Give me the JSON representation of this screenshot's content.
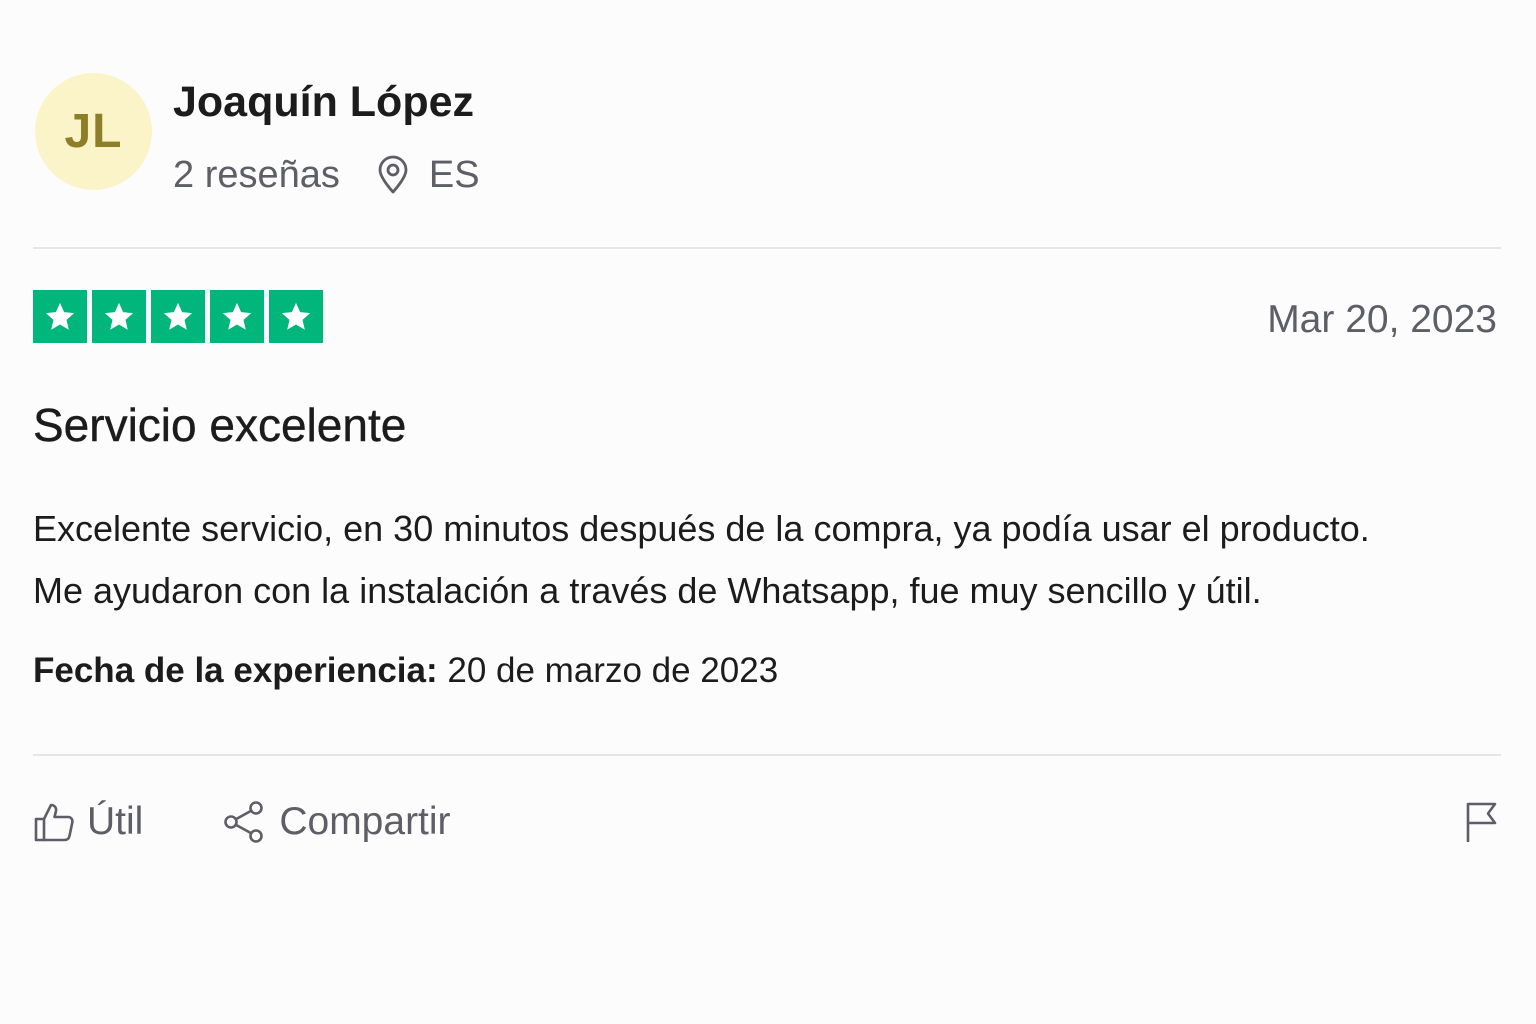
{
  "reviewer": {
    "initials": "JL",
    "name": "Joaquín López",
    "reviews_count": "2 reseñas",
    "country": "ES"
  },
  "review": {
    "rating": 5,
    "max_rating": 5,
    "date": "Mar 20, 2023",
    "title": "Servicio excelente",
    "body_line1": "Excelente servicio, en 30 minutos después de la compra, ya podía usar el producto.",
    "body_line2": "Me ayudaron con la instalación a través de Whatsapp, fue muy sencillo y útil.",
    "experience_label": "Fecha de la experiencia:",
    "experience_date": "20 de marzo de 2023"
  },
  "actions": {
    "useful_label": "Útil",
    "share_label": "Compartir"
  },
  "icons": {
    "location": "location-pin-icon",
    "useful": "thumbs-up-icon",
    "share": "share-icon",
    "report": "flag-icon",
    "star": "star-icon"
  },
  "colors": {
    "star_green": "#00b67a",
    "avatar_bg": "#fbf4c9",
    "avatar_text": "#8d7f28",
    "muted_text": "#5e5e66"
  }
}
